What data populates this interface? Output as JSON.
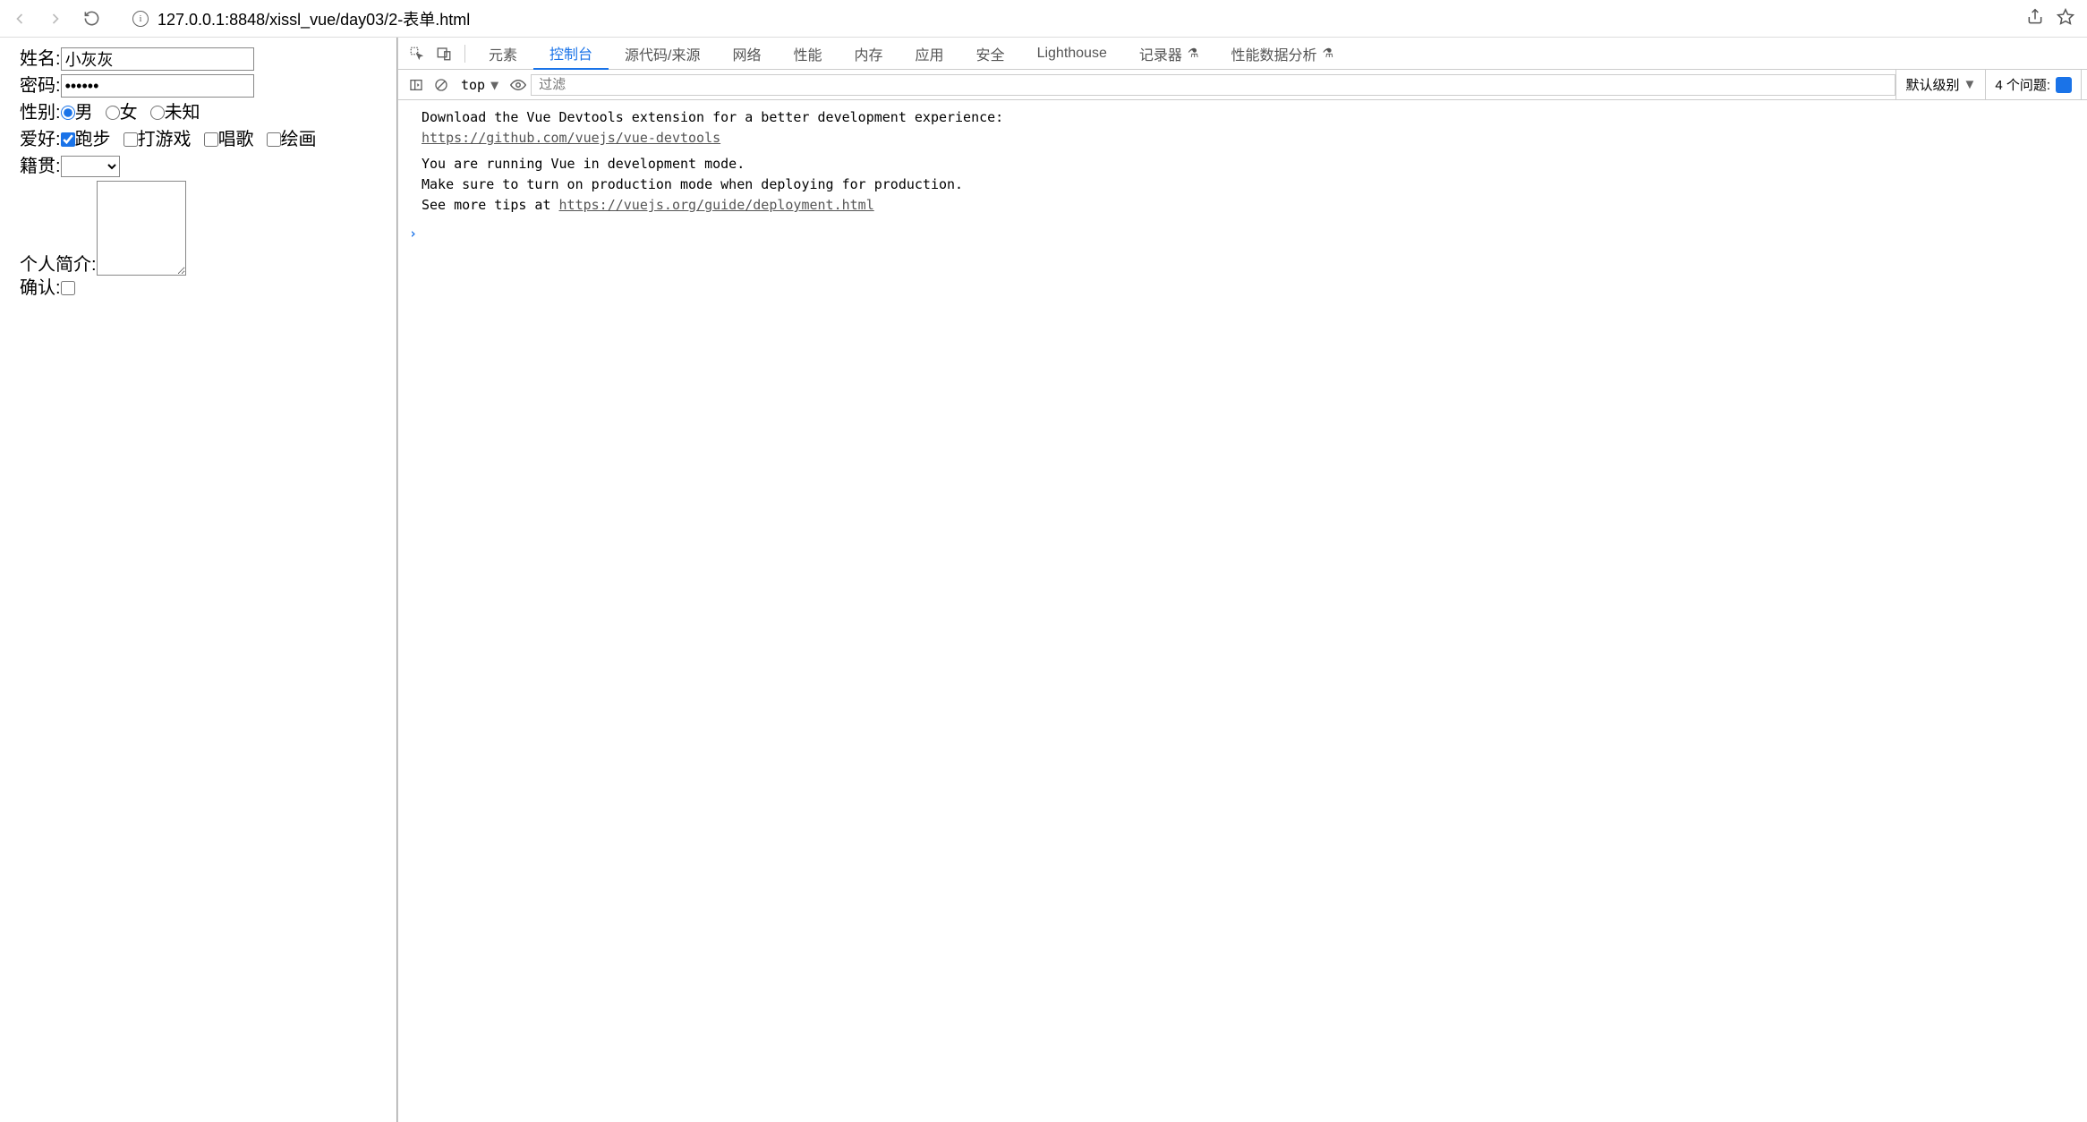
{
  "browser": {
    "url": "127.0.0.1:8848/xissl_vue/day03/2-表单.html"
  },
  "form": {
    "name_label": "姓名:",
    "name_value": "小灰灰",
    "password_label": "密码:",
    "password_value": "••••••",
    "gender_label": "性别:",
    "gender_options": {
      "male": "男",
      "female": "女",
      "unknown": "未知"
    },
    "hobby_label": "爱好:",
    "hobby_options": {
      "run": "跑步",
      "game": "打游戏",
      "sing": "唱歌",
      "paint": "绘画"
    },
    "hometown_label": "籍贯:",
    "bio_label": "个人简介:",
    "confirm_label": "确认:"
  },
  "devtools": {
    "tabs": {
      "elements": "元素",
      "console": "控制台",
      "sources": "源代码/来源",
      "network": "网络",
      "performance": "性能",
      "memory": "内存",
      "application": "应用",
      "security": "安全",
      "lighthouse": "Lighthouse",
      "recorder": "记录器",
      "insights": "性能数据分析"
    },
    "context": "top",
    "filter_placeholder": "过滤",
    "level_label": "默认级别",
    "issues_label": "4 个问题:",
    "logs": {
      "l1": "Download the Vue Devtools extension for a better development experience:",
      "l1_link": "https://github.com/vuejs/vue-devtools",
      "l2a": "You are running Vue in development mode.",
      "l2b": "Make sure to turn on production mode when deploying for production.",
      "l2c_prefix": "See more tips at ",
      "l2c_link": "https://vuejs.org/guide/deployment.html"
    }
  }
}
